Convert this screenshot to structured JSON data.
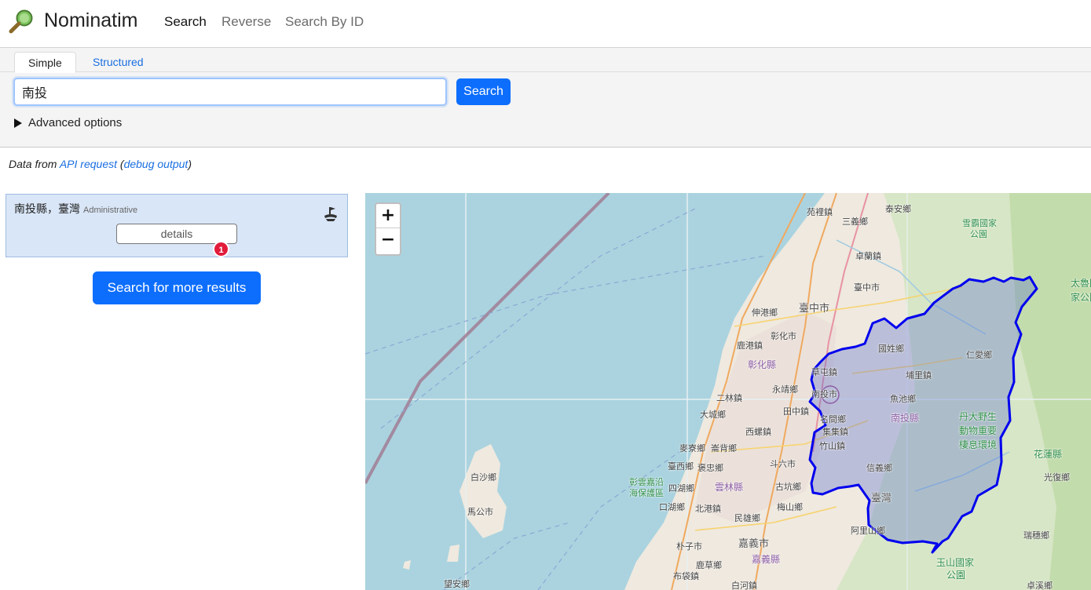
{
  "header": {
    "brand": "Nominatim",
    "nav": [
      "Search",
      "Reverse",
      "Search By ID"
    ]
  },
  "search": {
    "tabs": [
      "Simple",
      "Structured"
    ],
    "query": "南投",
    "button": "Search",
    "advanced": "Advanced options"
  },
  "data_from": {
    "prefix": "Data from ",
    "api_link": "API request",
    "open": " (",
    "debug_link": "debug output",
    "close": ")"
  },
  "result": {
    "name": "南投縣，臺灣",
    "type": "Administrative",
    "details": "details",
    "badge": "1"
  },
  "more_results": "Search for more results",
  "map": {
    "zoom_in": "+",
    "zoom_out": "−",
    "labels": {
      "l1": "苑裡鎮",
      "l2": "泰安鄉",
      "l3": "三義鄉",
      "l4": "雪霸國家",
      "l5": "公園",
      "l6": "卓蘭鎮",
      "l7": "臺中市",
      "l8": "太魯閣",
      "l9": "家公園",
      "l10": "臺中市",
      "l11": "伸港鄉",
      "l12": "彰化市",
      "l13": "鹿港鎮",
      "l14": "國姓鄉",
      "l15": "仁愛鄉",
      "l16": "彰化縣",
      "l17": "草屯鎮",
      "l18": "埔里鎮",
      "l19": "永靖鄉",
      "l20": "南投市",
      "l21": "二林鎮",
      "l22": "魚池鄉",
      "l23": "田中鎮",
      "l24": "大城鄉",
      "l25": "名間鄉",
      "l26": "南投縣",
      "l27": "丹大野生",
      "l28": "動物重要",
      "l29": "棲息環境",
      "l30": "西螺鎮",
      "l31": "集集鎮",
      "l32": "竹山鎮",
      "l33": "麥寮鄉",
      "l34": "崙背鄉",
      "l35": "斗六市",
      "l36": "花蓮縣",
      "l37": "臺西鄉",
      "l38": "褒忠鄉",
      "l39": "信義鄉",
      "l40": "白沙鄉",
      "l41": "彰雲嘉沿",
      "l42": "海保護區",
      "l43": "雲林縣",
      "l44": "古坑鄉",
      "l45": "光復鄉",
      "l46": "四湖鄉",
      "l47": "臺灣",
      "l48": "口湖鄉",
      "l49": "北港鎮",
      "l50": "梅山鄉",
      "l51": "馬公市",
      "l52": "民雄鄉",
      "l53": "阿里山鄉",
      "l54": "朴子市",
      "l55": "嘉義市",
      "l56": "瑞穗鄉",
      "l57": "嘉義縣",
      "l58": "鹿草鄉",
      "l59": "玉山國家",
      "l60": "公園",
      "l61": "布袋鎮",
      "l62": "白河鎮",
      "l63": "望安鄉",
      "l64": "卓溪鄉"
    }
  }
}
